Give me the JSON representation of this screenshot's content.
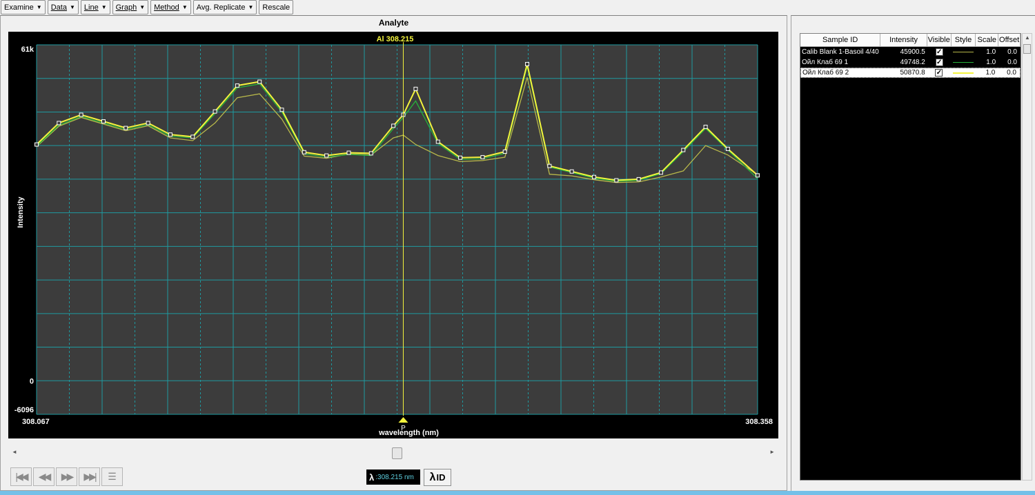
{
  "toolbar": {
    "menus": [
      {
        "label": "Examine"
      },
      {
        "label": "Data"
      },
      {
        "label": "Line"
      },
      {
        "label": "Graph"
      },
      {
        "label": "Method"
      },
      {
        "label": "Avg. Replicate"
      }
    ],
    "rescale_label": "Rescale"
  },
  "chart": {
    "panel_title": "Analyte",
    "line_label": "Al 308.215",
    "peak_marker": "P",
    "colors": {
      "background": "#000000",
      "plot": "#3c3c3c",
      "grid": "#1e9aa0",
      "cursor": "#f4f43c"
    }
  },
  "chart_data": {
    "type": "line",
    "xlabel": "wavelength (nm)",
    "ylabel": "Intensity",
    "xlim": [
      308.067,
      308.358
    ],
    "ylim": [
      -6096,
      61000
    ],
    "x_tick_labels": [
      "308.067",
      "308.358"
    ],
    "y_tick_labels": [
      "61k",
      "0",
      "-6096"
    ],
    "cursor_x": 308.215,
    "series": [
      {
        "name": "Calib Blank 1-Basoil 4/40",
        "color": "#b8b84a",
        "x": [
          308.067,
          308.076,
          308.085,
          308.094,
          308.103,
          308.112,
          308.121,
          308.13,
          308.139,
          308.148,
          308.157,
          308.166,
          308.175,
          308.184,
          308.193,
          308.202,
          308.211,
          308.215,
          308.22,
          308.229,
          308.238,
          308.247,
          308.256,
          308.265,
          308.274,
          308.283,
          308.292,
          308.301,
          308.31,
          308.319,
          308.328,
          308.337,
          308.346,
          308.358
        ],
        "y": [
          42500,
          46200,
          47800,
          46600,
          45400,
          46300,
          44100,
          43600,
          46800,
          51400,
          52100,
          47500,
          40800,
          40400,
          41200,
          41000,
          44100,
          44600,
          42900,
          40900,
          39800,
          40000,
          40600,
          55100,
          37500,
          37200,
          36500,
          36000,
          36100,
          37000,
          38100,
          42700,
          41000,
          37400
        ]
      },
      {
        "name": "Ойл Клаб 69 1",
        "color": "#27b43a",
        "x": [
          308.067,
          308.076,
          308.085,
          308.094,
          308.103,
          308.112,
          308.121,
          308.13,
          308.139,
          308.148,
          308.157,
          308.166,
          308.175,
          308.184,
          308.193,
          308.202,
          308.211,
          308.215,
          308.22,
          308.229,
          308.238,
          308.247,
          308.256,
          308.265,
          308.274,
          308.283,
          308.292,
          308.301,
          308.31,
          308.319,
          308.328,
          308.337,
          308.346,
          308.358
        ],
        "y": [
          42600,
          46400,
          48000,
          46800,
          45600,
          46500,
          44400,
          44100,
          48500,
          53200,
          53900,
          48800,
          41200,
          40600,
          41100,
          40900,
          45800,
          47800,
          50800,
          43100,
          40200,
          40300,
          41300,
          57100,
          38800,
          37800,
          36800,
          36200,
          36400,
          37600,
          41600,
          45800,
          41900,
          36700
        ]
      },
      {
        "name": "Ойл Клаб 69 2",
        "color": "#f4f43c",
        "x": [
          308.067,
          308.076,
          308.085,
          308.094,
          308.103,
          308.112,
          308.121,
          308.13,
          308.139,
          308.148,
          308.157,
          308.166,
          308.175,
          308.184,
          308.193,
          308.202,
          308.211,
          308.215,
          308.22,
          308.229,
          308.238,
          308.247,
          308.256,
          308.265,
          308.274,
          308.283,
          308.292,
          308.301,
          308.31,
          308.319,
          308.328,
          308.337,
          308.346,
          308.358
        ],
        "y": [
          42900,
          46800,
          48300,
          47100,
          45900,
          46800,
          44700,
          44300,
          48900,
          53600,
          54300,
          49200,
          41500,
          40900,
          41400,
          41300,
          46300,
          48300,
          53000,
          43400,
          40500,
          40600,
          41600,
          57500,
          39000,
          38000,
          37000,
          36400,
          36600,
          37800,
          41900,
          46100,
          42100,
          37300
        ]
      }
    ]
  },
  "wavelength_readout": {
    "symbol": "λ",
    "value": ":308.215 nm"
  },
  "lambda_id": {
    "symbol": "λ",
    "label": "ID"
  },
  "samples_table": {
    "headers": [
      "Sample ID",
      "Intensity",
      "Visible",
      "Style",
      "Scale",
      "Offset"
    ],
    "rows": [
      {
        "id": "Calib Blank 1-Basoil 4/40",
        "intensity": "45900.5",
        "visible": true,
        "color": "#b8b84a",
        "scale": "1.0",
        "offset": "0.0"
      },
      {
        "id": "Ойл Клаб 69 1",
        "intensity": "49748.2",
        "visible": true,
        "color": "#27b43a",
        "scale": "1.0",
        "offset": "0.0"
      },
      {
        "id": "Ойл Клаб 69 2",
        "intensity": "50870.8",
        "visible": true,
        "color": "#f4f43c",
        "scale": "1.0",
        "offset": "0.0"
      }
    ]
  }
}
